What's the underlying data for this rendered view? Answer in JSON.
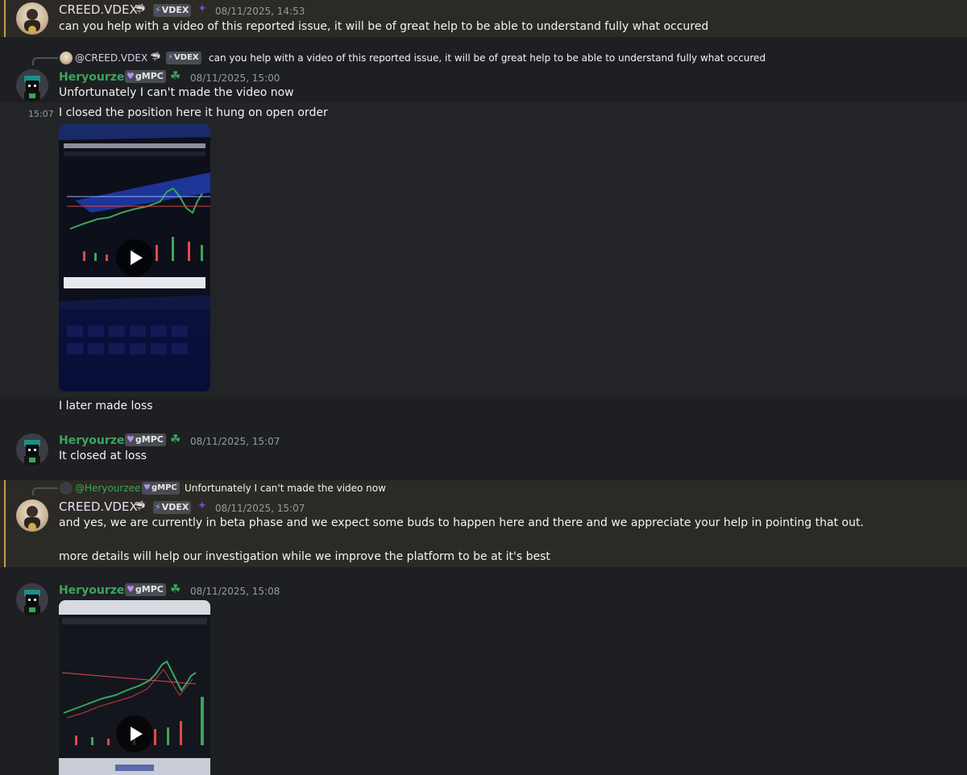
{
  "messages": [
    {
      "username": "CREED.VDEX",
      "tag": "VDEX",
      "timestamp": "08/11/2025, 14:53",
      "text": "can you help with a video of this reported issue, it will be of great help to be able to understand fully what occured"
    },
    {
      "reply": {
        "username": "@CREED.VDEX",
        "tag": "VDEX",
        "text": "can you help with a video of this reported issue, it will be of great help to be able to understand fully what occured"
      },
      "username": "Heryourzee",
      "tag": "gMPC",
      "timestamp": "08/11/2025, 15:00",
      "text": "Unfortunately I can't made the video now"
    },
    {
      "hover_time": "15:07",
      "text": "I closed the position here it hung on open order",
      "after_text": "I later made loss"
    },
    {
      "username": "Heryourzee",
      "tag": "gMPC",
      "timestamp": "08/11/2025, 15:07",
      "text": "It closed at loss"
    },
    {
      "reply": {
        "username": "@Heryourzee",
        "tag": "gMPC",
        "text": "Unfortunately I can't made the video now"
      },
      "username": "CREED.VDEX",
      "tag": "VDEX",
      "timestamp": "08/11/2025, 15:07",
      "text": "and yes, we are currently in beta phase and we expect some buds to happen here and there and we appreciate your help in pointing that out.",
      "text2": "more details will help our investigation while we improve the platform to be at it's best"
    },
    {
      "username": "Heryourzee",
      "tag": "gMPC",
      "timestamp": "08/11/2025, 15:08"
    }
  ],
  "colors": {
    "background": "#1e1f22",
    "highlight": "#2c2a24",
    "highlight_bar": "#c69c55",
    "hery_name": "#3ba55d",
    "timestamp": "#949ba4"
  }
}
